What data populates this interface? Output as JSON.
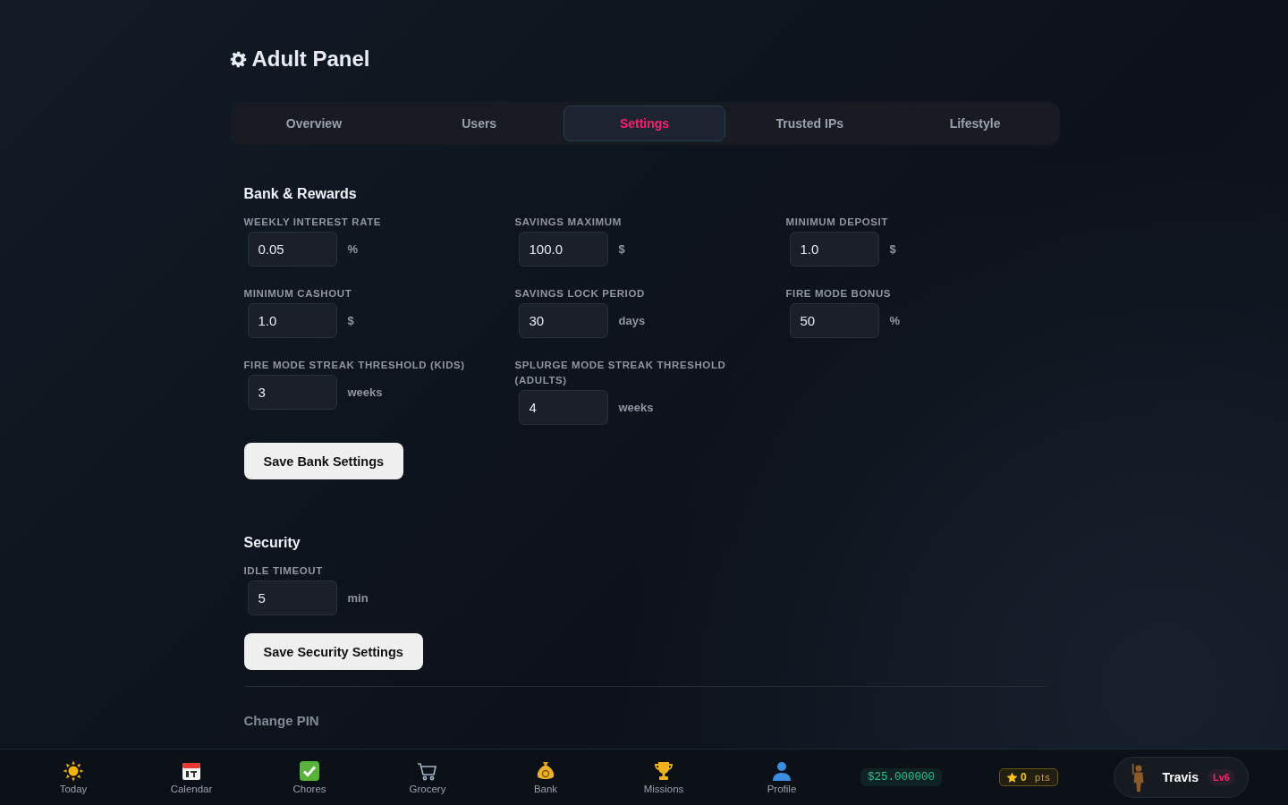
{
  "title": "Adult Panel",
  "tabs": [
    {
      "label": "Overview",
      "selected": false
    },
    {
      "label": "Users",
      "selected": false
    },
    {
      "label": "Settings",
      "selected": true
    },
    {
      "label": "Trusted IPs",
      "selected": false
    },
    {
      "label": "Lifestyle",
      "selected": false
    }
  ],
  "sections": [
    {
      "heading": "Bank & Rewards",
      "fields": [
        {
          "label": "WEEKLY INTEREST RATE",
          "value": "0.05",
          "unit": "%"
        },
        {
          "label": "SAVINGS MAXIMUM",
          "value": "100.0",
          "unit": "$"
        },
        {
          "label": "MINIMUM DEPOSIT",
          "value": "1.0",
          "unit": "$"
        },
        {
          "label": "MINIMUM CASHOUT",
          "value": "1.0",
          "unit": "$"
        },
        {
          "label": "SAVINGS LOCK PERIOD",
          "value": "30",
          "unit": "days"
        },
        {
          "label": "FIRE MODE BONUS",
          "value": "50",
          "unit": "%"
        },
        {
          "label": "FIRE MODE STREAK THRESHOLD (KIDS)",
          "value": "3",
          "unit": "weeks"
        },
        {
          "label": "SPLURGE MODE STREAK THRESHOLD (ADULTS)",
          "value": "4",
          "unit": "weeks"
        }
      ],
      "button": "Save Bank Settings"
    },
    {
      "heading": "Security",
      "fields": [
        {
          "label": "IDLE TIMEOUT",
          "value": "5",
          "unit": "min"
        }
      ],
      "button": "Save Security Settings"
    }
  ],
  "next_heading": "Change PIN",
  "nav": [
    {
      "kind": "sun",
      "label": "Today"
    },
    {
      "kind": "calendar",
      "label": "Calendar"
    },
    {
      "kind": "check",
      "label": "Chores"
    },
    {
      "kind": "cart",
      "label": "Grocery"
    },
    {
      "kind": "moneybag",
      "label": "Bank"
    },
    {
      "kind": "trophy",
      "label": "Missions"
    },
    {
      "kind": "person",
      "label": "Profile"
    }
  ],
  "balance": "$25.000000",
  "points": {
    "value": "0",
    "unit": "pts"
  },
  "user": {
    "name": "Travis",
    "level": "Lv6"
  }
}
